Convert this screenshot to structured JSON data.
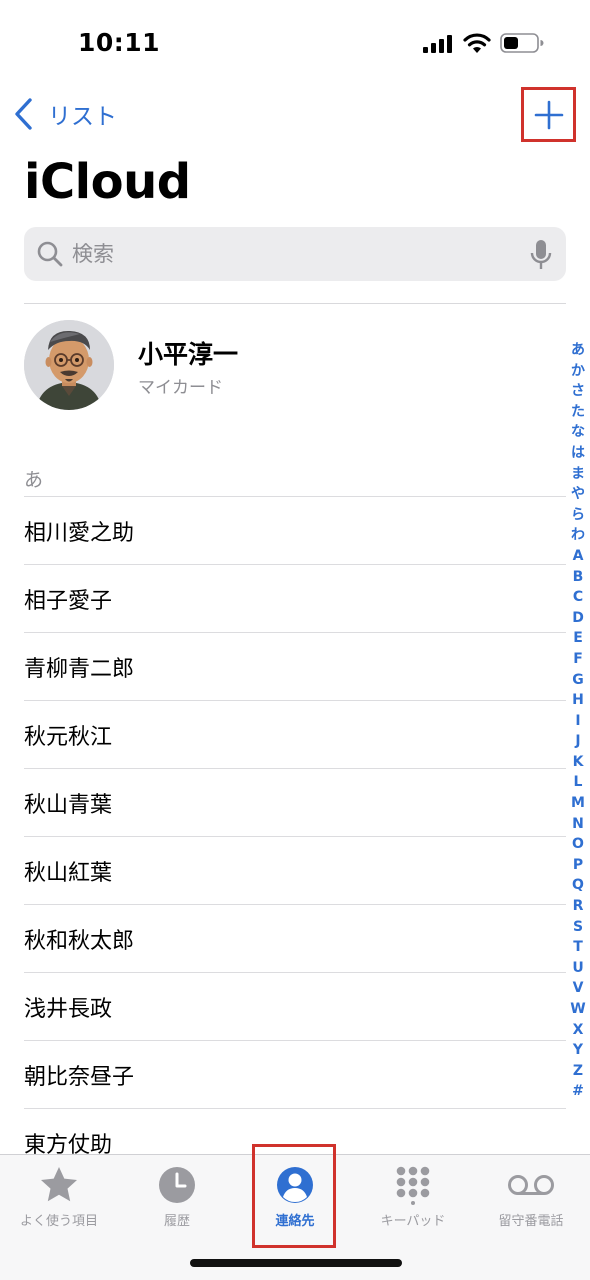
{
  "status_bar": {
    "time": "10:11"
  },
  "nav": {
    "back_label": "リスト"
  },
  "page": {
    "title": "iCloud"
  },
  "search": {
    "placeholder": "検索"
  },
  "my_card": {
    "name": "小平淳一",
    "subtitle": "マイカード"
  },
  "section": {
    "header": "あ"
  },
  "contacts": [
    "相川愛之助",
    "相子愛子",
    "青柳青二郎",
    "秋元秋江",
    "秋山青葉",
    "秋山紅葉",
    "秋和秋太郎",
    "浅井長政",
    "朝比奈昼子",
    "東方仗助"
  ],
  "index": [
    "あ",
    "か",
    "さ",
    "た",
    "な",
    "は",
    "ま",
    "や",
    "ら",
    "わ",
    "A",
    "B",
    "C",
    "D",
    "E",
    "F",
    "G",
    "H",
    "I",
    "J",
    "K",
    "L",
    "M",
    "N",
    "O",
    "P",
    "Q",
    "R",
    "S",
    "T",
    "U",
    "V",
    "W",
    "X",
    "Y",
    "Z",
    "#"
  ],
  "tabs": [
    {
      "label": "よく使う項目",
      "icon": "star-icon"
    },
    {
      "label": "履歴",
      "icon": "clock-icon"
    },
    {
      "label": "連絡先",
      "icon": "person-circle-icon",
      "active": true
    },
    {
      "label": "キーパッド",
      "icon": "keypad-icon"
    },
    {
      "label": "留守番電話",
      "icon": "voicemail-icon"
    }
  ],
  "colors": {
    "accent": "#2f6fd1",
    "highlight": "#d0322c",
    "inactive": "#9b9ba0"
  }
}
